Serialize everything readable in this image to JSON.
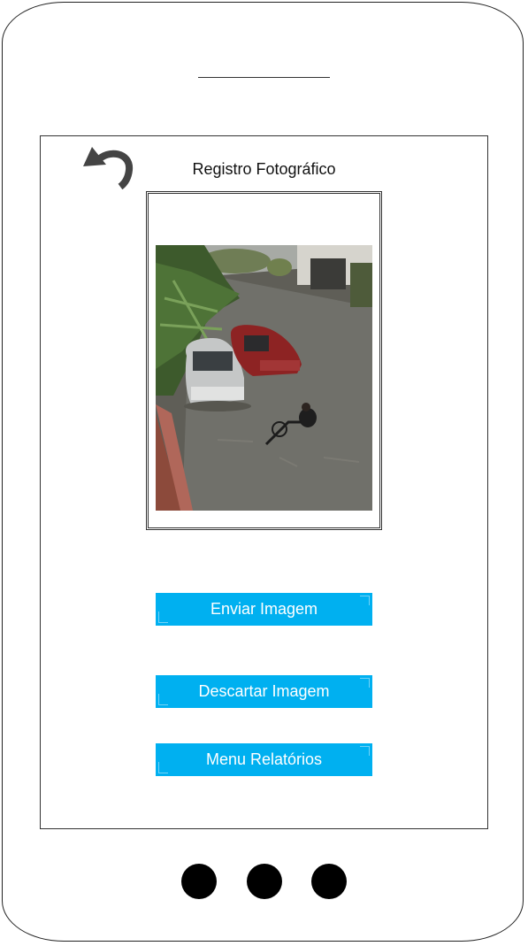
{
  "header": {
    "title": "Registro Fotográfico",
    "back_icon": "undo-arrow-icon"
  },
  "photo": {
    "description_icon": "flooded-street-photo"
  },
  "buttons": {
    "send_label": "Enviar Imagem",
    "discard_label": "Descartar Imagem",
    "menu_label": "Menu Relatórios"
  },
  "colors": {
    "button_bg": "#00b0f0",
    "button_text": "#ffffff"
  }
}
